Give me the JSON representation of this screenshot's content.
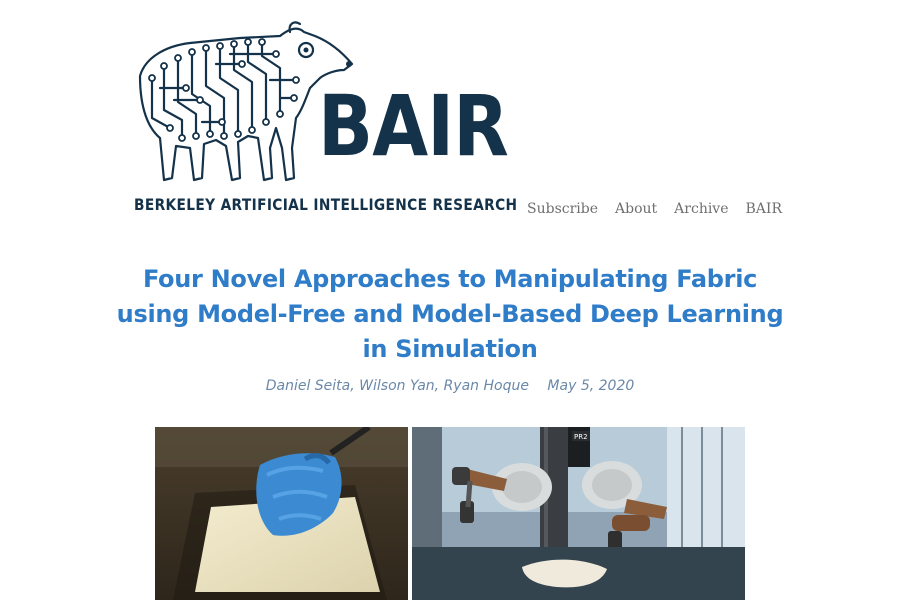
{
  "site": {
    "logo_word": "BAIR",
    "logo_subtitle": "BERKELEY ARTIFICIAL INTELLIGENCE RESEARCH"
  },
  "nav": {
    "items": [
      {
        "label": "Subscribe"
      },
      {
        "label": "About"
      },
      {
        "label": "Archive"
      },
      {
        "label": "BAIR"
      }
    ]
  },
  "post": {
    "title_lines": [
      "Four Novel Approaches to Manipulating Fabric",
      "using Model-Free and Model-Based Deep Learning",
      "in Simulation"
    ],
    "authors": "Daniel Seita, Wilson Yan, Ryan Hoque",
    "date": "May 5, 2020",
    "robot_badge": "PR2"
  },
  "colors": {
    "brand_navy": "#14324a",
    "title_blue": "#2f7cc9",
    "nav_gray": "#6f6f6f",
    "meta_blue": "#6a88a8"
  }
}
